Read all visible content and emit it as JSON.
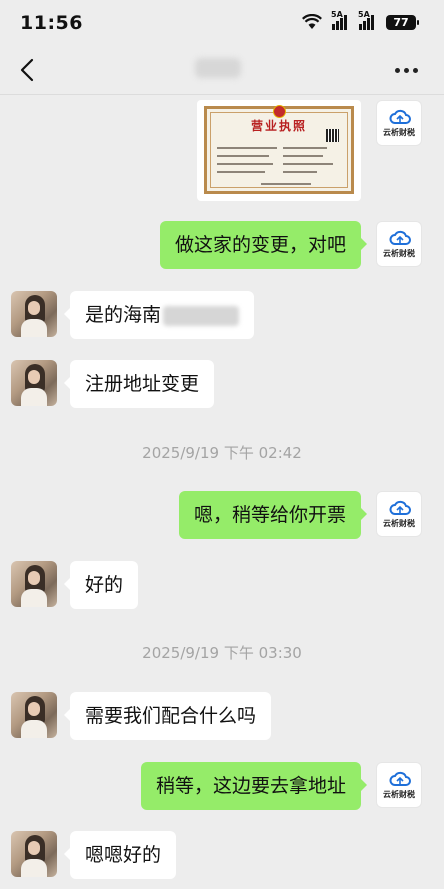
{
  "status_bar": {
    "time": "11:56",
    "network_1": "5A",
    "network_2": "5A",
    "battery": "77"
  },
  "chat": {
    "my_avatar_label": "云析财税"
  },
  "certificate": {
    "title": "营业执照"
  },
  "messages": [
    {
      "side": "out",
      "text": "做这家的变更，对吧"
    },
    {
      "side": "in",
      "text": "是的海南"
    },
    {
      "side": "in",
      "text": "注册地址变更"
    },
    {
      "side": "out",
      "text": "嗯，稍等给你开票"
    },
    {
      "side": "in",
      "text": "好的"
    },
    {
      "side": "in",
      "text": "需要我们配合什么吗"
    },
    {
      "side": "out",
      "text": "稍等，这边要去拿地址"
    },
    {
      "side": "in",
      "text": "嗯嗯好的"
    }
  ],
  "timestamps": [
    "2025/9/19 下午 02:42",
    "2025/9/19 下午 03:30"
  ],
  "colors": {
    "background": "#ededed",
    "outgoing_bubble": "#95ec69",
    "incoming_bubble": "#ffffff"
  }
}
